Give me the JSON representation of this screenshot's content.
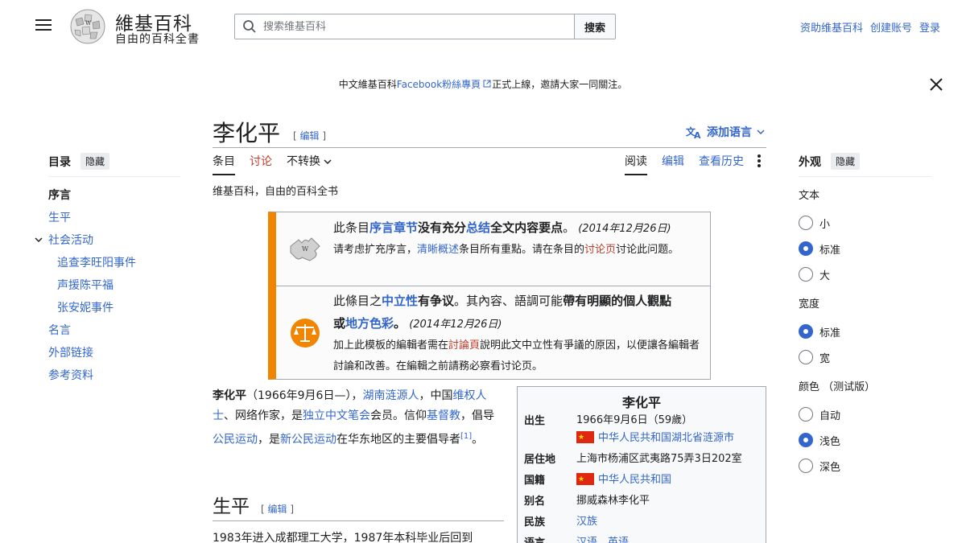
{
  "header": {
    "wordmark": "維基百科",
    "tagline": "自由的百科全書",
    "search_placeholder": "搜索维基百科",
    "search_button": "搜索",
    "user_links": [
      "资助维基百科",
      "创建账号",
      "登录"
    ]
  },
  "notice": {
    "before": "中文維基百科",
    "link": "Facebook粉絲專頁",
    "after": "正式上線，邀請大家一同關注。"
  },
  "toc": {
    "title": "目录",
    "hide": "隐藏",
    "items": [
      {
        "label": "序言"
      },
      {
        "label": "生平"
      },
      {
        "label": "社会活动"
      },
      {
        "label": "追查李旺阳事件"
      },
      {
        "label": "声援陈平福"
      },
      {
        "label": "张安妮事件"
      },
      {
        "label": "名言"
      },
      {
        "label": "外部链接"
      },
      {
        "label": "参考资料"
      }
    ]
  },
  "article": {
    "title": "李化平",
    "edit_open": "[",
    "edit": "编辑",
    "edit_close": "]",
    "add_languages": "添加语言",
    "tabs_left": [
      "条目",
      "讨论",
      "不转换"
    ],
    "tabs_right": [
      "阅读",
      "编辑",
      "查看历史"
    ],
    "subtitle": "维基百科，自由的百科全书"
  },
  "ambox": {
    "r1_a": "此条目",
    "r1_link1": "序言章节",
    "r1_b": "没有充分",
    "r1_link2": "总结",
    "r1_c": "全文内容要点",
    "r1_d": "。",
    "r1_date": "(2014年12月26日)",
    "r1_e": "请考虑扩充序言，",
    "r1_link3": "清晰概述",
    "r1_f": "条目所有重點。请在条目的",
    "r1_link4": "讨论页",
    "r1_g": "讨论此问题。",
    "r2_a": "此條目之",
    "r2_link1": "中立性",
    "r2_b": "有争议",
    "r2_c": "。其內容、語調可能",
    "r2_d": "帶有明顯的個人觀點",
    "r2_e": "或",
    "r2_link2": "地方色彩",
    "r2_f": "。",
    "r2_date": "(2014年12月26日)",
    "r2_g": "加上此模板的編輯者需在",
    "r2_link3": "討論頁",
    "r2_h": "說明此文中立性有爭議的原因，以便讓各編輯者討論和改善。在編輯之前請務必察看讨论页。"
  },
  "lead": {
    "name": "李化平",
    "a": "（1966年9月6日—），",
    "l1": "湖南涟源人",
    "b": "，中国",
    "l2": "维权人士",
    "c": "、网络作家，是",
    "l3": "独立中文笔会",
    "d": "会员。信仰",
    "l4": "基督教",
    "e": "，倡导",
    "l5": "公民运动",
    "f": "，是",
    "l6": "新公民运动",
    "g": "在华东地区的主要倡导者",
    "ref": "[1]",
    "h": "。"
  },
  "section": {
    "title": "生平",
    "para": "1983年进入成都理工大学，1987年本科毕业后回到"
  },
  "infobox": {
    "title": "李化平",
    "rows": [
      {
        "label": "出生",
        "v1": "1966年9月6日（59歲）",
        "v2": "中华人民共和国湖北省涟源市"
      },
      {
        "label": "居住地",
        "v1": "上海市杨浦区武夷路75弄3日202室"
      },
      {
        "label": "国籍",
        "v1": "中华人民共和国"
      },
      {
        "label": "别名",
        "v1": "挪威森林李化平"
      },
      {
        "label": "民族",
        "v1": "汉族"
      },
      {
        "label": "语言",
        "v1": "汉语、英语"
      }
    ]
  },
  "appearance": {
    "title": "外观",
    "hide": "隐藏",
    "text_label": "文本",
    "text_options": [
      "小",
      "标准",
      "大"
    ],
    "width_label": "宽度",
    "width_options": [
      "标准",
      "宽"
    ],
    "color_label": "颜色 （测试版）",
    "color_options": [
      "自动",
      "浅色",
      "深色"
    ]
  },
  "colors": {
    "link": "#3366cc",
    "ambox_border": "#f28500",
    "redlink": "#bf3c2c"
  }
}
